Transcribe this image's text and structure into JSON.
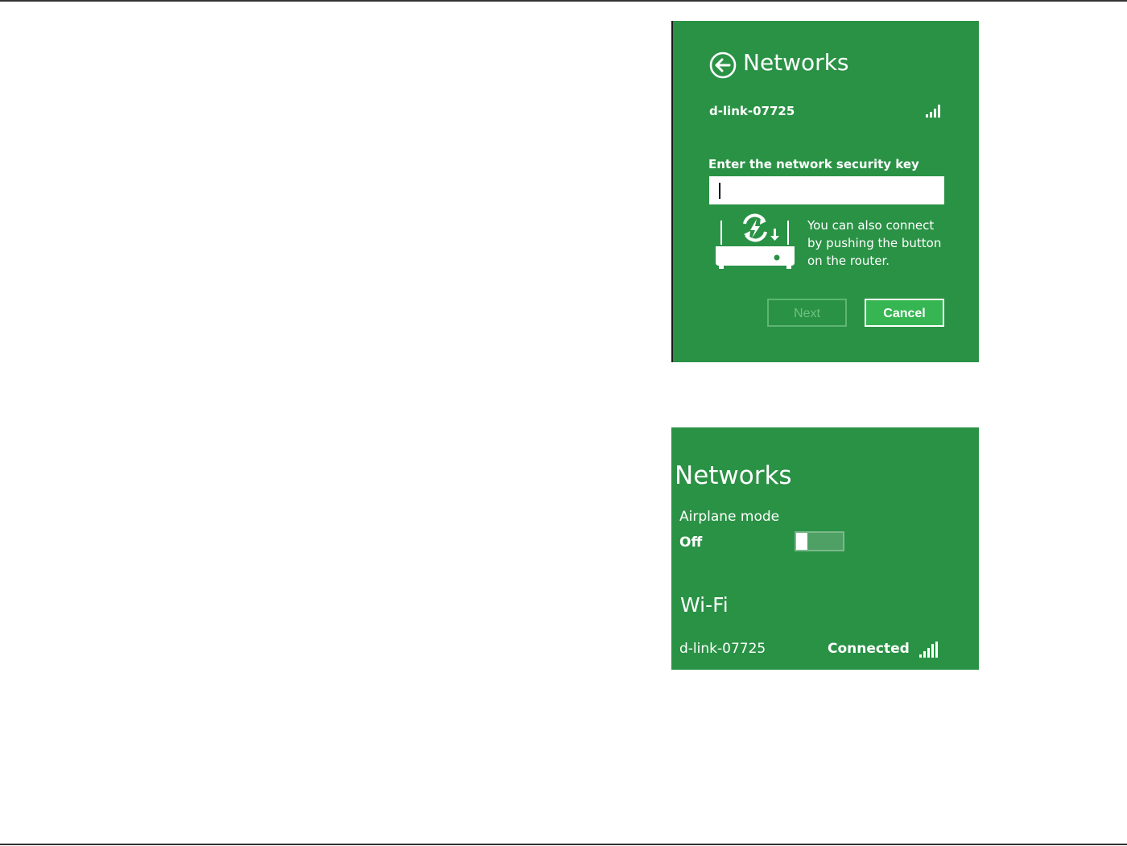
{
  "connect_dialog": {
    "title": "Networks",
    "network_name": "d-link-07725",
    "key_label": "Enter the network security key",
    "key_value": "",
    "wps_hint": "You can also connect by pushing the button on the router.",
    "next_label": "Next",
    "cancel_label": "Cancel",
    "icons": {
      "back": "back-arrow-icon",
      "signal": "wifi-signal-icon",
      "router": "router-wps-icon"
    }
  },
  "networks_panel": {
    "title": "Networks",
    "airplane_mode_label": "Airplane mode",
    "airplane_mode_state": "Off",
    "wifi_section_label": "Wi-Fi",
    "wifi_network_name": "d-link-07725",
    "wifi_network_status": "Connected",
    "icons": {
      "signal": "wifi-signal-icon"
    }
  },
  "colors": {
    "panel_background": "#2a9245",
    "cancel_button": "#36b553",
    "text": "#ffffff",
    "page_rules": "#333333"
  }
}
